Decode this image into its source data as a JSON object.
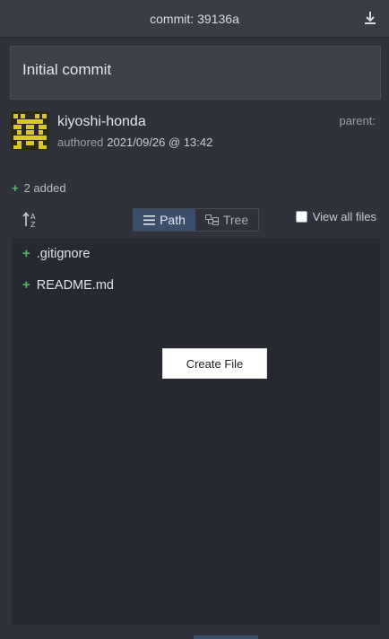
{
  "header": {
    "label": "commit:",
    "hash": "39136a",
    "download_icon": "download-icon"
  },
  "commit": {
    "message": "Initial commit",
    "author": "kiyoshi-honda",
    "authored_label": "authored",
    "authored_date": "2021/09/26 @ 13:42",
    "parent_label": "parent:"
  },
  "summary": {
    "plus": "+",
    "added_text": "2 added"
  },
  "toolbar": {
    "sort_icon": "sort-alpha-icon",
    "path_label": "Path",
    "tree_label": "Tree",
    "view_all_label": "View all files",
    "view_all_checked": false
  },
  "files": [
    {
      "status": "+",
      "name": ".gitignore"
    },
    {
      "status": "+",
      "name": "README.md"
    }
  ],
  "create_file_label": "Create File",
  "colors": {
    "added_green": "#52b96b",
    "active_toggle": "#3b4e6c",
    "panel_bg": "#262930"
  }
}
